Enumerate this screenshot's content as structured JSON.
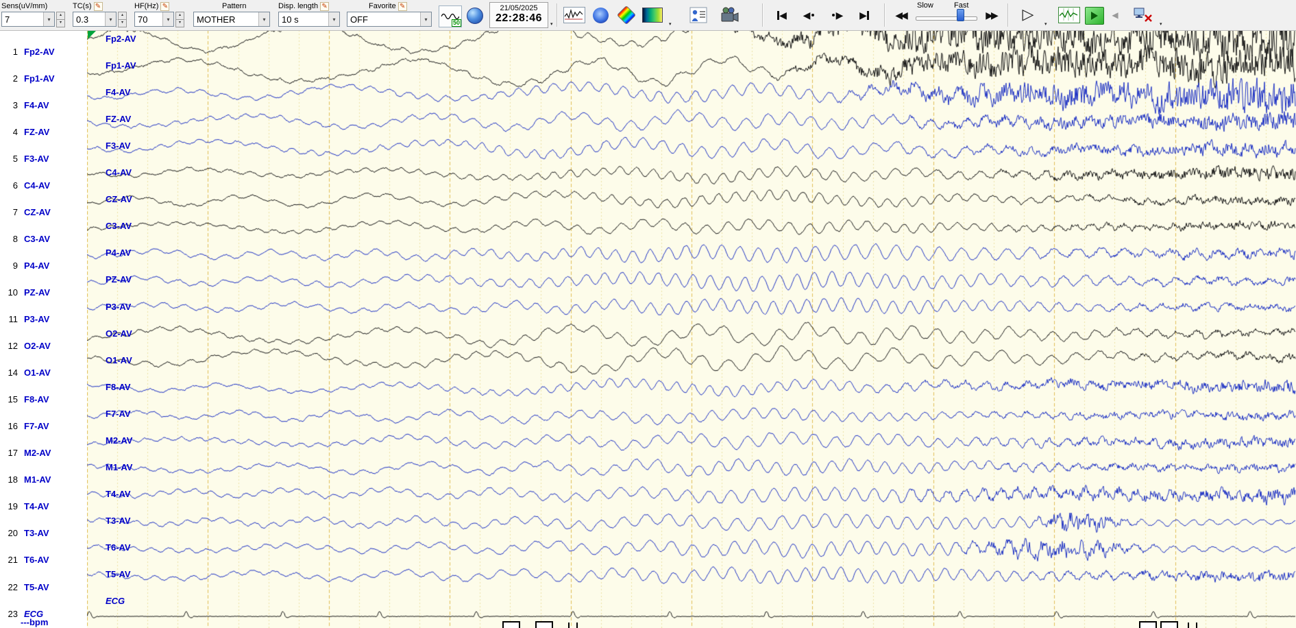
{
  "toolbar": {
    "fields": {
      "sens": {
        "label": "Sens(uV/mm)",
        "value": "7"
      },
      "tc": {
        "label": "TC(s)",
        "value": "0.3"
      },
      "hf": {
        "label": "HF(Hz)",
        "value": "70"
      },
      "pattern": {
        "label": "Pattern",
        "value": "MOTHER"
      },
      "disp": {
        "label": "Disp. length",
        "value": "10 s"
      },
      "favorite": {
        "label": "Favorite",
        "value": "OFF"
      }
    },
    "notch_badge": "50",
    "datetime": {
      "date": "21/05/2025",
      "time": "22:28:46"
    },
    "speed": {
      "slow": "Slow",
      "fast": "Fast"
    }
  },
  "plot": {
    "bg": "#fdfcea",
    "grid_minor": "#ece0a4",
    "grid_major": "#e0be55",
    "seconds": 10,
    "minor_per_second": 4
  },
  "colors": {
    "trace_black": "#141414",
    "trace_blue": "#1b2fc4",
    "label_blue": "#0000c8"
  },
  "ecg_bpm": "---bpm",
  "channels": [
    {
      "num": "1",
      "label": "Fp2-AV",
      "color": "black",
      "wave": {
        "slow": 15,
        "rhy": 5,
        "rf": 5.0,
        "noise": 2.2,
        "art": 24,
        "as": 0.5,
        "bc": 0.55,
        "bw": 0.2
      }
    },
    {
      "num": "2",
      "label": "Fp1-AV",
      "color": "black",
      "wave": {
        "slow": 14,
        "rhy": 5,
        "rf": 5.1,
        "noise": 2.2,
        "art": 21,
        "as": 0.55,
        "bc": 0.55,
        "bw": 0.2
      }
    },
    {
      "num": "3",
      "label": "F4-AV",
      "color": "blue",
      "wave": {
        "slow": 7,
        "rhy": 7,
        "rf": 6.0,
        "noise": 1.8,
        "art": 19,
        "as": 0.6,
        "bc": 0.55,
        "bw": 0.22
      }
    },
    {
      "num": "4",
      "label": "FZ-AV",
      "color": "blue",
      "wave": {
        "slow": 7,
        "rhy": 7,
        "rf": 6.1,
        "noise": 1.8,
        "art": 9,
        "as": 0.62,
        "bc": 0.55,
        "bw": 0.22
      }
    },
    {
      "num": "5",
      "label": "F3-AV",
      "color": "blue",
      "wave": {
        "slow": 7,
        "rhy": 7,
        "rf": 6.2,
        "noise": 1.8,
        "art": 7,
        "as": 0.65,
        "bc": 0.55,
        "bw": 0.22
      }
    },
    {
      "num": "6",
      "label": "C4-AV",
      "color": "black",
      "wave": {
        "slow": 5,
        "rhy": 6,
        "rf": 6.4,
        "noise": 1.6,
        "art": 7,
        "as": 0.68,
        "bc": 0.58,
        "bw": 0.22
      }
    },
    {
      "num": "7",
      "label": "CZ-AV",
      "color": "black",
      "wave": {
        "slow": 6,
        "rhy": 6,
        "rf": 6.3,
        "noise": 1.6,
        "art": 4,
        "as": 0.7,
        "bc": 0.58,
        "bw": 0.22
      }
    },
    {
      "num": "8",
      "label": "C3-AV",
      "color": "black",
      "wave": {
        "slow": 5,
        "rhy": 6,
        "rf": 6.5,
        "noise": 1.6,
        "art": 4,
        "as": 0.7,
        "bc": 0.58,
        "bw": 0.22
      }
    },
    {
      "num": "9",
      "label": "P4-AV",
      "color": "blue",
      "wave": {
        "slow": 4,
        "rhy": 9,
        "rf": 6.0,
        "noise": 1.5,
        "art": 4,
        "as": 0.7,
        "bc": 0.6,
        "bw": 0.24
      }
    },
    {
      "num": "10",
      "label": "PZ-AV",
      "color": "blue",
      "wave": {
        "slow": 4,
        "rhy": 9,
        "rf": 6.1,
        "noise": 1.5,
        "art": 3,
        "as": 0.72,
        "bc": 0.6,
        "bw": 0.24
      }
    },
    {
      "num": "11",
      "label": "P3-AV",
      "color": "blue",
      "wave": {
        "slow": 4,
        "rhy": 8,
        "rf": 6.2,
        "noise": 1.5,
        "art": 3,
        "as": 0.72,
        "bc": 0.6,
        "bw": 0.24
      }
    },
    {
      "num": "12",
      "label": "O2-AV",
      "color": "black",
      "wave": {
        "slow": 9,
        "rhy": 8,
        "rf": 5.3,
        "noise": 1.5,
        "art": 3,
        "as": 0.75,
        "bc": 0.62,
        "bw": 0.24
      }
    },
    {
      "num": "14",
      "label": "O1-AV",
      "color": "black",
      "wave": {
        "slow": 9,
        "rhy": 8,
        "rf": 5.2,
        "noise": 1.5,
        "art": 3,
        "as": 0.75,
        "bc": 0.62,
        "bw": 0.24
      }
    },
    {
      "num": "15",
      "label": "F8-AV",
      "color": "blue",
      "wave": {
        "slow": 5,
        "rhy": 6,
        "rf": 6.4,
        "noise": 1.6,
        "art": 6,
        "as": 0.62,
        "bc": 0.55,
        "bw": 0.22
      }
    },
    {
      "num": "16",
      "label": "F7-AV",
      "color": "blue",
      "wave": {
        "slow": 5,
        "rhy": 6,
        "rf": 6.3,
        "noise": 1.6,
        "art": 4,
        "as": 0.65,
        "bc": 0.55,
        "bw": 0.22
      }
    },
    {
      "num": "17",
      "label": "M2-AV",
      "color": "blue",
      "wave": {
        "slow": 5,
        "rhy": 7,
        "rf": 6.2,
        "noise": 1.6,
        "art": 5,
        "as": 0.66,
        "bc": 0.58,
        "bw": 0.22
      }
    },
    {
      "num": "18",
      "label": "M1-AV",
      "color": "blue",
      "wave": {
        "slow": 5,
        "rhy": 7,
        "rf": 6.1,
        "noise": 1.6,
        "art": 4,
        "as": 0.66,
        "bc": 0.58,
        "bw": 0.22
      }
    },
    {
      "num": "19",
      "label": "T4-AV",
      "color": "blue",
      "wave": {
        "slow": 4,
        "rhy": 8,
        "rf": 6.3,
        "noise": 1.5,
        "art": 7,
        "as": 0.62,
        "bc": 0.6,
        "bw": 0.24
      }
    },
    {
      "num": "20",
      "label": "T3-AV",
      "color": "blue",
      "wave": {
        "slow": 4,
        "rhy": 8,
        "rf": 6.2,
        "noise": 1.5,
        "art": 15,
        "as": 0.82,
        "aw": 0.03,
        "bc": 0.6,
        "bw": 0.24
      }
    },
    {
      "num": "21",
      "label": "T6-AV",
      "color": "blue",
      "wave": {
        "slow": 4,
        "rhy": 8,
        "rf": 6.0,
        "noise": 1.5,
        "art": 13,
        "as": 0.8,
        "aw": 0.06,
        "bc": 0.6,
        "bw": 0.24
      }
    },
    {
      "num": "22",
      "label": "T5-AV",
      "color": "blue",
      "wave": {
        "slow": 4,
        "rhy": 8,
        "rf": 6.1,
        "noise": 1.5,
        "art": 5,
        "as": 0.7,
        "bc": 0.6,
        "bw": 0.24
      }
    },
    {
      "num": "23",
      "label": "ECG",
      "color": "black",
      "italic": true,
      "type": "ecg",
      "wave": {
        "beat_s": 0.8,
        "spike": 7,
        "noise": 0.9
      }
    }
  ]
}
